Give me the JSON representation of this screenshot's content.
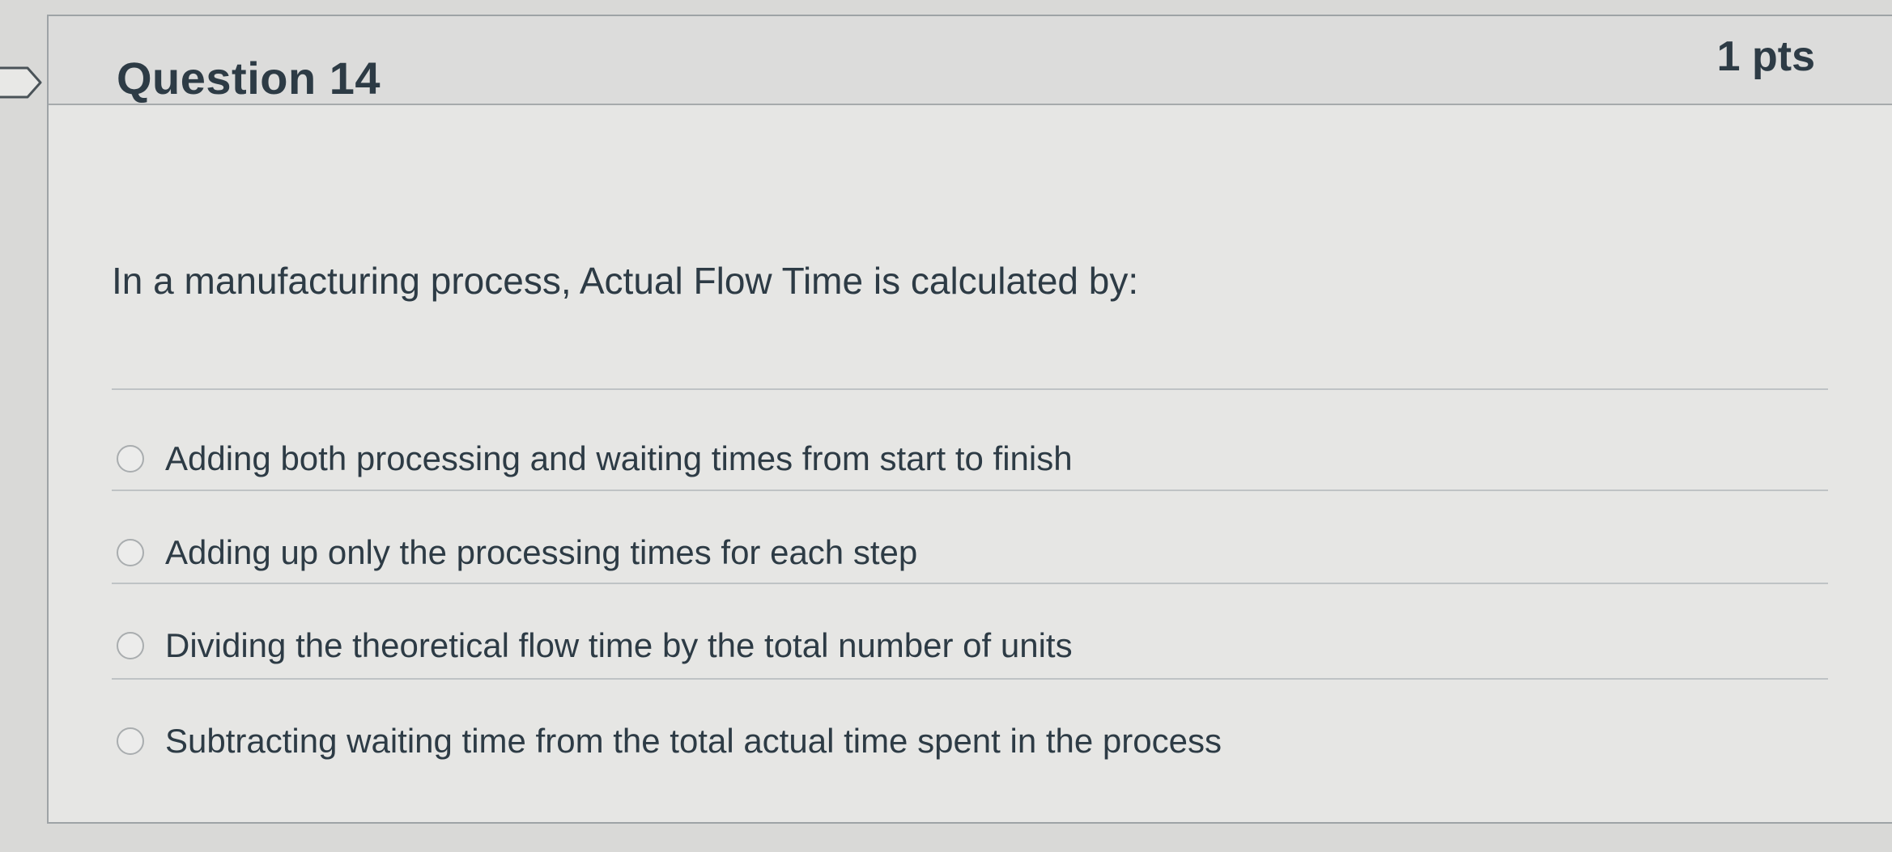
{
  "question": {
    "title": "Question 14",
    "points": "1 pts",
    "prompt": "In a manufacturing process, Actual Flow Time is calculated by:",
    "answers": [
      {
        "label": "Adding both processing and waiting times from start to finish"
      },
      {
        "label": "Adding up only the processing times for each step"
      },
      {
        "label": "Dividing the theoretical flow time by the total number of units"
      },
      {
        "label": "Subtracting waiting time from the total actual time spent in the process"
      }
    ]
  }
}
